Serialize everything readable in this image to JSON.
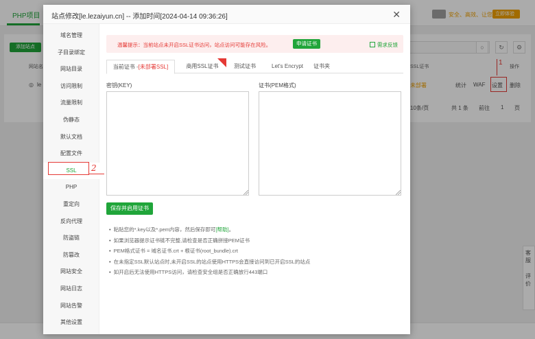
{
  "background": {
    "top_tab": "PHP项目",
    "warn_text": "安全、高效、让您更安心",
    "badge_left": "",
    "badge_right": "立即体验",
    "add_site_button": "添加站点",
    "headers": {
      "site_name": "网站名",
      "ssl_cert": "SSL证书",
      "action": "操作"
    },
    "row": {
      "site": "le",
      "ssl_status": "未部署",
      "actions": [
        "统计",
        "WAF",
        "设置",
        "删除"
      ]
    },
    "pagination": {
      "per_page": "10条/页",
      "total": "共 1 条",
      "goto_label": "前往",
      "page": "1",
      "page_unit": "页"
    },
    "annotation_1": "1",
    "side_tab_1": "客服",
    "side_tab_2": "评价"
  },
  "dialog": {
    "title": "站点修改[le.lezaiyun.cn] -- 添加时间[2024-04-14 09:36:26]",
    "close_icon": "close-icon",
    "sidebar": {
      "items": [
        "域名管理",
        "子目录绑定",
        "网站目录",
        "访问限制",
        "流量限制",
        "伪静态",
        "默认文档",
        "配置文件",
        "SSL",
        "PHP",
        "重定向",
        "反向代理",
        "防盗链",
        "防篡改",
        "网站安全",
        "网站日志",
        "网站告警",
        "其他设置"
      ],
      "active_index": 8
    },
    "annotation_2": "2",
    "alert": {
      "text": "温馨提示：当前站点未开启SSL证书访问，站点访问可能存在风险。",
      "apply_button": "申请证书",
      "feedback_link": "需求反馈"
    },
    "tabs": [
      {
        "label": "当前证书 -",
        "status": "[未部署SSL]"
      },
      {
        "label": "商用SSL证书",
        "hot": true
      },
      {
        "label": "测试证书"
      },
      {
        "label": "Let's Encrypt"
      },
      {
        "label": "证书夹"
      }
    ],
    "key_label": "密钥(KEY)",
    "cert_label": "证书(PEM格式)",
    "key_value": "",
    "cert_value": "",
    "save_button": "保存并启用证书",
    "tips": [
      {
        "text": "粘贴您的*.key以及*.pem内容，然后保存即可",
        "link": "[帮助]",
        "suffix": "。"
      },
      {
        "text": "如果浏览器提示证书链不完整,请检查是否正确拼接PEM证书"
      },
      {
        "text": "PEM格式证书 = 域名证书.crt + 根证书(root_bundle).crt"
      },
      {
        "text": "在未指定SSL默认站点时,未开启SSL的站点使用HTTPS会直接访问到已开启SSL的站点"
      },
      {
        "text": "如开启后无法使用HTTPS访问，请检查安全组是否正确放行443端口"
      }
    ]
  },
  "colors": {
    "accent": "#20a53a",
    "danger": "#e53935",
    "warning": "#f0a000"
  }
}
